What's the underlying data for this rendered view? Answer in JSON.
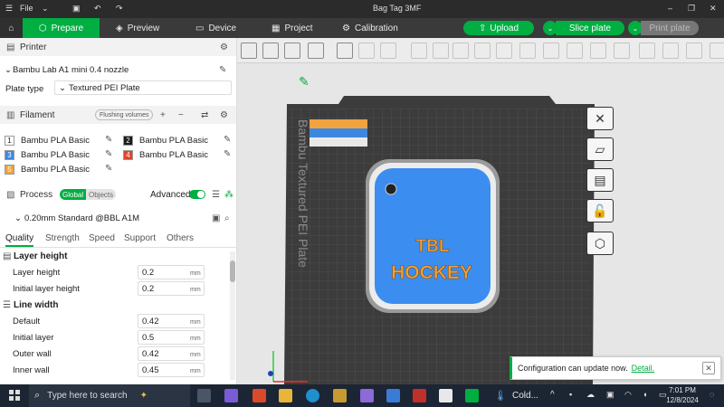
{
  "titlebar": {
    "menu": "File",
    "title": "Bag Tag 3MF"
  },
  "nav": {
    "prepare": "Prepare",
    "preview": "Preview",
    "device": "Device",
    "project": "Project",
    "calibration": "Calibration"
  },
  "actions": {
    "upload": "Upload",
    "slice": "Slice plate",
    "print": "Print plate"
  },
  "printer": {
    "header": "Printer",
    "name": "Bambu Lab A1 mini 0.4 nozzle",
    "plate_label": "Plate type",
    "plate_value": "Textured PEI Plate"
  },
  "filament": {
    "header": "Filament",
    "flushing": "Flushing volumes",
    "items": [
      {
        "num": "1",
        "name": "Bambu PLA Basic",
        "color": "#ffffff",
        "text": "#222222"
      },
      {
        "num": "2",
        "name": "Bambu PLA Basic",
        "color": "#1a1a1a",
        "text": "#ffffff"
      },
      {
        "num": "3",
        "name": "Bambu PLA Basic",
        "color": "#3d87e0",
        "text": "#ffffff"
      },
      {
        "num": "4",
        "name": "Bambu PLA Basic",
        "color": "#e0452c",
        "text": "#ffffff"
      },
      {
        "num": "5",
        "name": "Bambu PLA Basic",
        "color": "#f0a33e",
        "text": "#ffffff"
      }
    ]
  },
  "process": {
    "header": "Process",
    "global": "Global",
    "objects": "Objects",
    "advanced": "Advanced",
    "profile": "0.20mm Standard @BBL A1M",
    "tabs": [
      "Quality",
      "Strength",
      "Speed",
      "Support",
      "Others"
    ],
    "group_layer": "Layer height",
    "layer_height_label": "Layer height",
    "layer_height": "0.2",
    "initial_layer_height_label": "Initial layer height",
    "initial_layer_height": "0.2",
    "group_line": "Line width",
    "default_label": "Default",
    "default": "0.42",
    "initial_layer_label": "Initial layer",
    "initial_layer": "0.5",
    "outer_wall_label": "Outer wall",
    "outer_wall": "0.42",
    "inner_wall_label": "Inner wall",
    "inner_wall": "0.45",
    "unit": "mm"
  },
  "viewport": {
    "plate_text": "Bambu Textured PEI Plate",
    "tag_line1": "TBL",
    "tag_line2": "HOCKEY",
    "tag_color": "#3b8ef0",
    "tag_text_color": "#f0a040"
  },
  "notice": {
    "text": "Configuration can update now.",
    "link": "Detail."
  },
  "taskbar": {
    "search": "Type here to search",
    "weather": "Cold...",
    "time": "7:01 PM",
    "date": "12/8/2024"
  },
  "colors": {
    "accent": "#00ae42",
    "dark": "#3a3a3a"
  }
}
